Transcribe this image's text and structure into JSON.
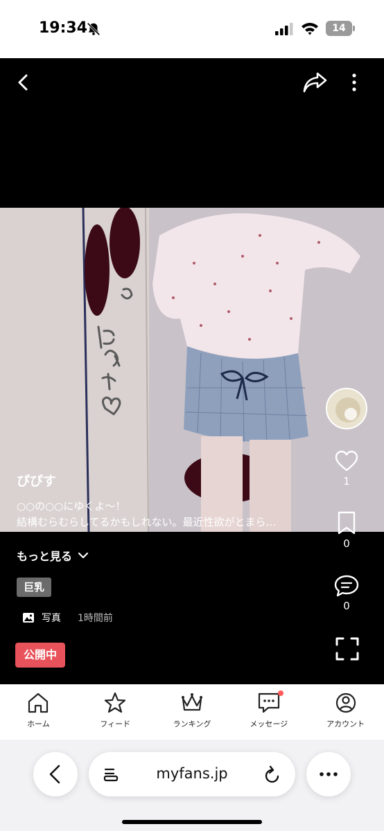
{
  "status_bar": {
    "time": "19:34",
    "battery": "14"
  },
  "post": {
    "username": "ぴぴす",
    "caption_line1": "○○の○○にゆくよ〜！",
    "caption_line2": "結構むらむらしてるかもしれない。最近性欲がとまら…",
    "more_label": "もっと見る",
    "tag": "巨乳",
    "media_type": "写真",
    "posted_ago": "1時間前",
    "status": "公開中",
    "handwritten_note": "のにゆく♡"
  },
  "actions": {
    "likes": "1",
    "bookmarks": "0",
    "comments": "0"
  },
  "tabbar": {
    "items": [
      {
        "label": "ホーム",
        "icon": "home-icon"
      },
      {
        "label": "フィード",
        "icon": "star-icon"
      },
      {
        "label": "ランキング",
        "icon": "crown-icon"
      },
      {
        "label": "メッセージ",
        "icon": "message-icon"
      },
      {
        "label": "アカウント",
        "icon": "account-icon"
      }
    ]
  },
  "browser": {
    "url": "myfans.jp"
  },
  "colors": {
    "status_pill": "#e8525a",
    "tag_bg": "#6b6b6b",
    "notification_dot": "#ff5a5a"
  }
}
